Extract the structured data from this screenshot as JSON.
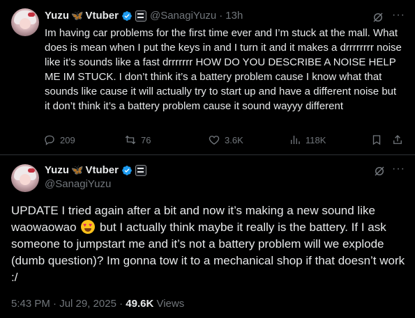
{
  "tweet1": {
    "name": "Yuzu",
    "name_suffix": "Vtuber",
    "handle": "@SanagiYuzu",
    "time": "13h",
    "text": "Im having car problems for the first time ever and I’m stuck at the mall. What does is mean when I put the keys in and I turn it and it makes a drrrrrrrr noise like it’s sounds like a fast drrrrrrr HOW DO YOU DESCRIBE A NOISE HELP ME IM STUCK. I don’t think it’s a battery problem cause I know what that sounds like cause it will actually try to start up and have a different noise but it don’t think it’s a battery problem cause it sound wayyy different",
    "replies": "209",
    "reposts": "76",
    "likes": "3.6K",
    "views": "118K"
  },
  "tweet2": {
    "name": "Yuzu",
    "name_suffix": "Vtuber",
    "handle": "@SanagiYuzu",
    "text_before_emoji": "UPDATE I tried again after a bit and now it’s making a new sound like waowaowao",
    "text_after_emoji": "but I actually think maybe it really is the battery. If I ask someone to jumpstart me and it’s not a battery problem will we explode (dumb question)? Im gonna tow it to a mechanical shop if that doesn’t work :/",
    "timestamp": "5:43 PM · Jul 29, 2025",
    "views_count": "49.6K",
    "views_label": "Views"
  },
  "icons": {
    "butterfly": "butterfly-icon",
    "verified": "verified-badge-icon",
    "affiliate": "affiliate-badge-icon",
    "grok": "grok-icon",
    "more": "more-icon",
    "reply": "reply-icon",
    "repost": "repost-icon",
    "like": "heart-icon",
    "views": "views-chart-icon",
    "bookmark": "bookmark-icon",
    "share": "share-icon"
  },
  "colors": {
    "background": "#000000",
    "text": "#e7e9ea",
    "secondary": "#71767b",
    "verified": "#1d9bf0",
    "divider": "#2f3336"
  }
}
